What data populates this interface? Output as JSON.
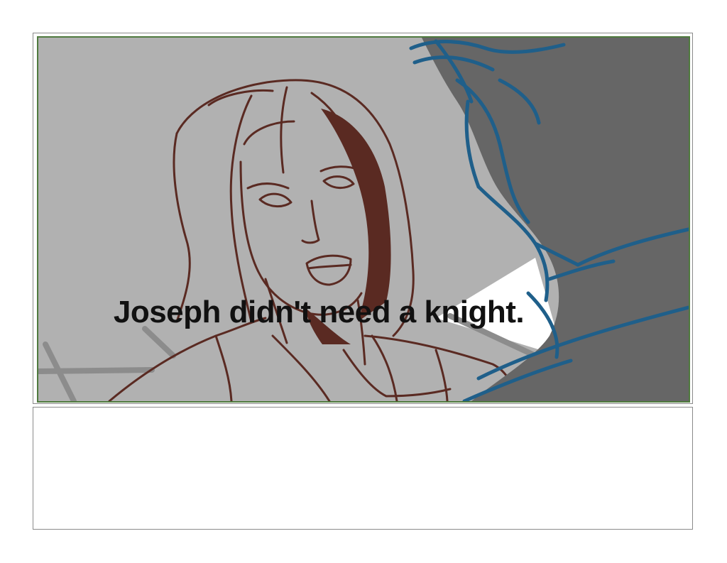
{
  "panel": {
    "caption": "Joseph didn't need a knight.",
    "colors": {
      "background": "#b1b1b1",
      "sketch_line": "#5a2a22",
      "figure_line": "#1f5f8a",
      "shadow": "#666666",
      "frame_border": "#4f7a3e"
    }
  },
  "notes": {
    "text": ""
  }
}
